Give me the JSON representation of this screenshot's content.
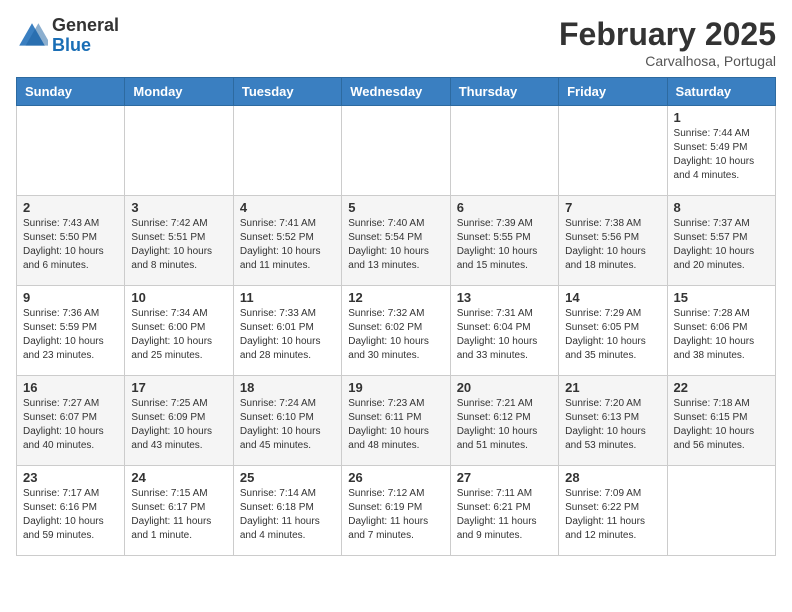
{
  "header": {
    "logo_general": "General",
    "logo_blue": "Blue",
    "month_title": "February 2025",
    "location": "Carvalhosa, Portugal"
  },
  "weekdays": [
    "Sunday",
    "Monday",
    "Tuesday",
    "Wednesday",
    "Thursday",
    "Friday",
    "Saturday"
  ],
  "weeks": [
    [
      {
        "day": "",
        "info": ""
      },
      {
        "day": "",
        "info": ""
      },
      {
        "day": "",
        "info": ""
      },
      {
        "day": "",
        "info": ""
      },
      {
        "day": "",
        "info": ""
      },
      {
        "day": "",
        "info": ""
      },
      {
        "day": "1",
        "info": "Sunrise: 7:44 AM\nSunset: 5:49 PM\nDaylight: 10 hours\nand 4 minutes."
      }
    ],
    [
      {
        "day": "2",
        "info": "Sunrise: 7:43 AM\nSunset: 5:50 PM\nDaylight: 10 hours\nand 6 minutes."
      },
      {
        "day": "3",
        "info": "Sunrise: 7:42 AM\nSunset: 5:51 PM\nDaylight: 10 hours\nand 8 minutes."
      },
      {
        "day": "4",
        "info": "Sunrise: 7:41 AM\nSunset: 5:52 PM\nDaylight: 10 hours\nand 11 minutes."
      },
      {
        "day": "5",
        "info": "Sunrise: 7:40 AM\nSunset: 5:54 PM\nDaylight: 10 hours\nand 13 minutes."
      },
      {
        "day": "6",
        "info": "Sunrise: 7:39 AM\nSunset: 5:55 PM\nDaylight: 10 hours\nand 15 minutes."
      },
      {
        "day": "7",
        "info": "Sunrise: 7:38 AM\nSunset: 5:56 PM\nDaylight: 10 hours\nand 18 minutes."
      },
      {
        "day": "8",
        "info": "Sunrise: 7:37 AM\nSunset: 5:57 PM\nDaylight: 10 hours\nand 20 minutes."
      }
    ],
    [
      {
        "day": "9",
        "info": "Sunrise: 7:36 AM\nSunset: 5:59 PM\nDaylight: 10 hours\nand 23 minutes."
      },
      {
        "day": "10",
        "info": "Sunrise: 7:34 AM\nSunset: 6:00 PM\nDaylight: 10 hours\nand 25 minutes."
      },
      {
        "day": "11",
        "info": "Sunrise: 7:33 AM\nSunset: 6:01 PM\nDaylight: 10 hours\nand 28 minutes."
      },
      {
        "day": "12",
        "info": "Sunrise: 7:32 AM\nSunset: 6:02 PM\nDaylight: 10 hours\nand 30 minutes."
      },
      {
        "day": "13",
        "info": "Sunrise: 7:31 AM\nSunset: 6:04 PM\nDaylight: 10 hours\nand 33 minutes."
      },
      {
        "day": "14",
        "info": "Sunrise: 7:29 AM\nSunset: 6:05 PM\nDaylight: 10 hours\nand 35 minutes."
      },
      {
        "day": "15",
        "info": "Sunrise: 7:28 AM\nSunset: 6:06 PM\nDaylight: 10 hours\nand 38 minutes."
      }
    ],
    [
      {
        "day": "16",
        "info": "Sunrise: 7:27 AM\nSunset: 6:07 PM\nDaylight: 10 hours\nand 40 minutes."
      },
      {
        "day": "17",
        "info": "Sunrise: 7:25 AM\nSunset: 6:09 PM\nDaylight: 10 hours\nand 43 minutes."
      },
      {
        "day": "18",
        "info": "Sunrise: 7:24 AM\nSunset: 6:10 PM\nDaylight: 10 hours\nand 45 minutes."
      },
      {
        "day": "19",
        "info": "Sunrise: 7:23 AM\nSunset: 6:11 PM\nDaylight: 10 hours\nand 48 minutes."
      },
      {
        "day": "20",
        "info": "Sunrise: 7:21 AM\nSunset: 6:12 PM\nDaylight: 10 hours\nand 51 minutes."
      },
      {
        "day": "21",
        "info": "Sunrise: 7:20 AM\nSunset: 6:13 PM\nDaylight: 10 hours\nand 53 minutes."
      },
      {
        "day": "22",
        "info": "Sunrise: 7:18 AM\nSunset: 6:15 PM\nDaylight: 10 hours\nand 56 minutes."
      }
    ],
    [
      {
        "day": "23",
        "info": "Sunrise: 7:17 AM\nSunset: 6:16 PM\nDaylight: 10 hours\nand 59 minutes."
      },
      {
        "day": "24",
        "info": "Sunrise: 7:15 AM\nSunset: 6:17 PM\nDaylight: 11 hours\nand 1 minute."
      },
      {
        "day": "25",
        "info": "Sunrise: 7:14 AM\nSunset: 6:18 PM\nDaylight: 11 hours\nand 4 minutes."
      },
      {
        "day": "26",
        "info": "Sunrise: 7:12 AM\nSunset: 6:19 PM\nDaylight: 11 hours\nand 7 minutes."
      },
      {
        "day": "27",
        "info": "Sunrise: 7:11 AM\nSunset: 6:21 PM\nDaylight: 11 hours\nand 9 minutes."
      },
      {
        "day": "28",
        "info": "Sunrise: 7:09 AM\nSunset: 6:22 PM\nDaylight: 11 hours\nand 12 minutes."
      },
      {
        "day": "",
        "info": ""
      }
    ]
  ]
}
